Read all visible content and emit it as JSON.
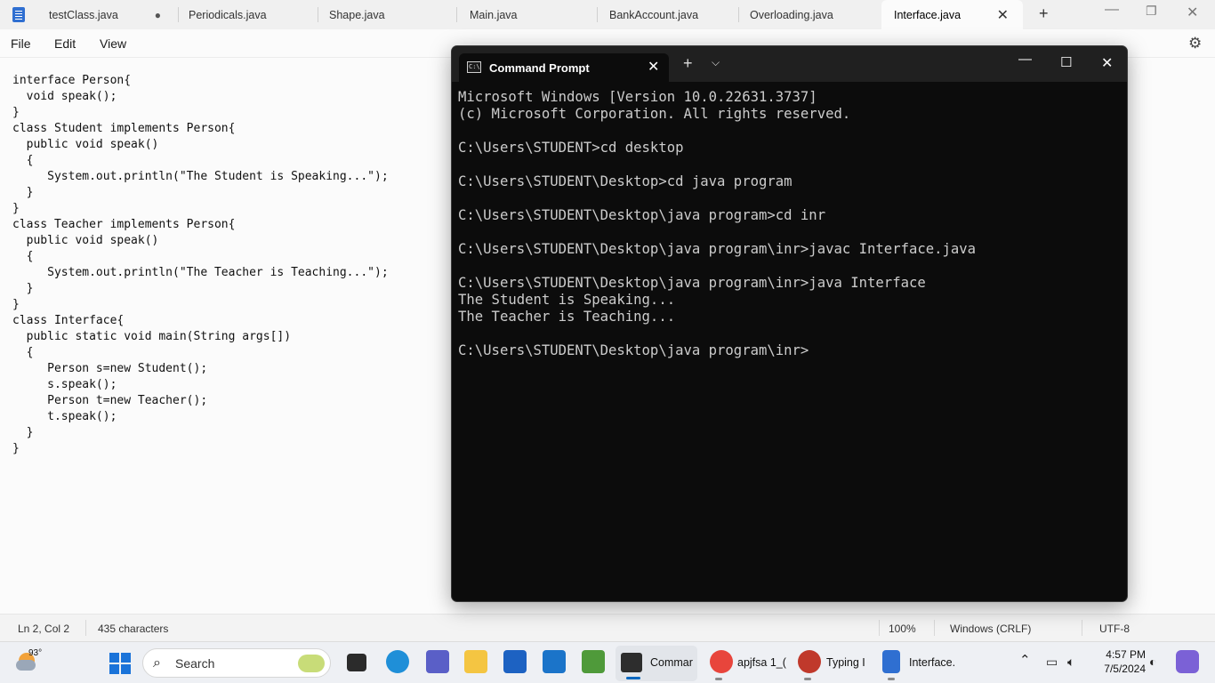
{
  "notepad": {
    "tabs": [
      {
        "label": "testClass.java",
        "unsaved": true
      },
      {
        "label": "Periodicals.java"
      },
      {
        "label": "Shape.java"
      },
      {
        "label": "Main.java"
      },
      {
        "label": "BankAccount.java"
      },
      {
        "label": "Overloading.java"
      },
      {
        "label": "Interface.java",
        "active": true
      }
    ],
    "menu": [
      "File",
      "Edit",
      "View"
    ],
    "code": "interface Person{\n  void speak();\n}\nclass Student implements Person{\n  public void speak()\n  {\n     System.out.println(\"The Student is Speaking...\");\n  }\n}\nclass Teacher implements Person{\n  public void speak()\n  {\n     System.out.println(\"The Teacher is Teaching...\");\n  }\n}\nclass Interface{\n  public static void main(String args[])\n  {\n     Person s=new Student();\n     s.speak();\n     Person t=new Teacher();\n     t.speak();\n  }\n}",
    "status": {
      "position": "Ln 2, Col 2",
      "characters": "435 characters",
      "zoom": "100%",
      "line_endings": "Windows (CRLF)",
      "encoding": "UTF-8"
    }
  },
  "cmd": {
    "tab_title": "Command Prompt",
    "icon_text": "C:\\",
    "output": "Microsoft Windows [Version 10.0.22631.3737]\n(c) Microsoft Corporation. All rights reserved.\n\nC:\\Users\\STUDENT>cd desktop\n\nC:\\Users\\STUDENT\\Desktop>cd java program\n\nC:\\Users\\STUDENT\\Desktop\\java program>cd inr\n\nC:\\Users\\STUDENT\\Desktop\\java program\\inr>javac Interface.java\n\nC:\\Users\\STUDENT\\Desktop\\java program\\inr>java Interface\nThe Student is Speaking...\nThe Teacher is Teaching...\n\nC:\\Users\\STUDENT\\Desktop\\java program\\inr>"
  },
  "taskbar": {
    "weather_temp": "93°",
    "search_placeholder": "Search",
    "apps": [
      {
        "label": "Commar",
        "active": true
      },
      {
        "label": "apjfsa 1_("
      },
      {
        "label": "Typing I"
      },
      {
        "label": "Interface."
      }
    ],
    "time": "4:57 PM",
    "date": "7/5/2024"
  },
  "colors": {
    "notepad_bg": "#fbfbfb",
    "cmd_bg": "#0c0c0c",
    "cmd_text": "#cccccc",
    "accent": "#0067c0"
  }
}
